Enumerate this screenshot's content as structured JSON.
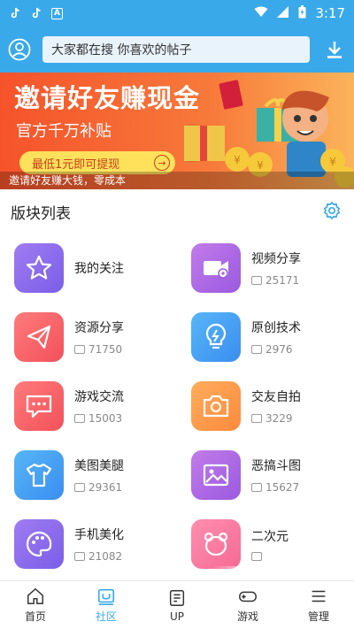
{
  "status_bar": {
    "time": "3:17"
  },
  "search": {
    "placeholder": "大家都在搜  你喜欢的帖子"
  },
  "banner": {
    "title": "邀请好友赚现金",
    "subtitle": "官方千万补贴",
    "button_label": "最低1元即可提现",
    "caption": "邀请好友赚大钱，零成本"
  },
  "section": {
    "title": "版块列表"
  },
  "boards": [
    {
      "name": "我的关注",
      "count": "",
      "icon": "star-icon"
    },
    {
      "name": "视频分享",
      "count": "25171",
      "icon": "video-icon"
    },
    {
      "name": "资源分享",
      "count": "71750",
      "icon": "paper-plane-icon"
    },
    {
      "name": "原创技术",
      "count": "2976",
      "icon": "lightbulb-icon"
    },
    {
      "name": "游戏交流",
      "count": "15003",
      "icon": "chat-icon"
    },
    {
      "name": "交友自拍",
      "count": "3229",
      "icon": "camera-icon"
    },
    {
      "name": "美图美腿",
      "count": "29361",
      "icon": "shirt-icon"
    },
    {
      "name": "恶搞斗图",
      "count": "15627",
      "icon": "image-icon"
    },
    {
      "name": "手机美化",
      "count": "21082",
      "icon": "palette-icon"
    },
    {
      "name": "二次元",
      "count": "",
      "icon": "bear-icon"
    }
  ],
  "nav": [
    {
      "label": "首页",
      "icon": "home-icon"
    },
    {
      "label": "社区",
      "icon": "community-icon"
    },
    {
      "label": "UP",
      "icon": "up-icon"
    },
    {
      "label": "游戏",
      "icon": "game-icon"
    },
    {
      "label": "管理",
      "icon": "manage-icon"
    }
  ],
  "colors": {
    "primary": "#3aa9ea",
    "banner_start": "#f6532b",
    "banner_pill": "#ffe15c"
  }
}
